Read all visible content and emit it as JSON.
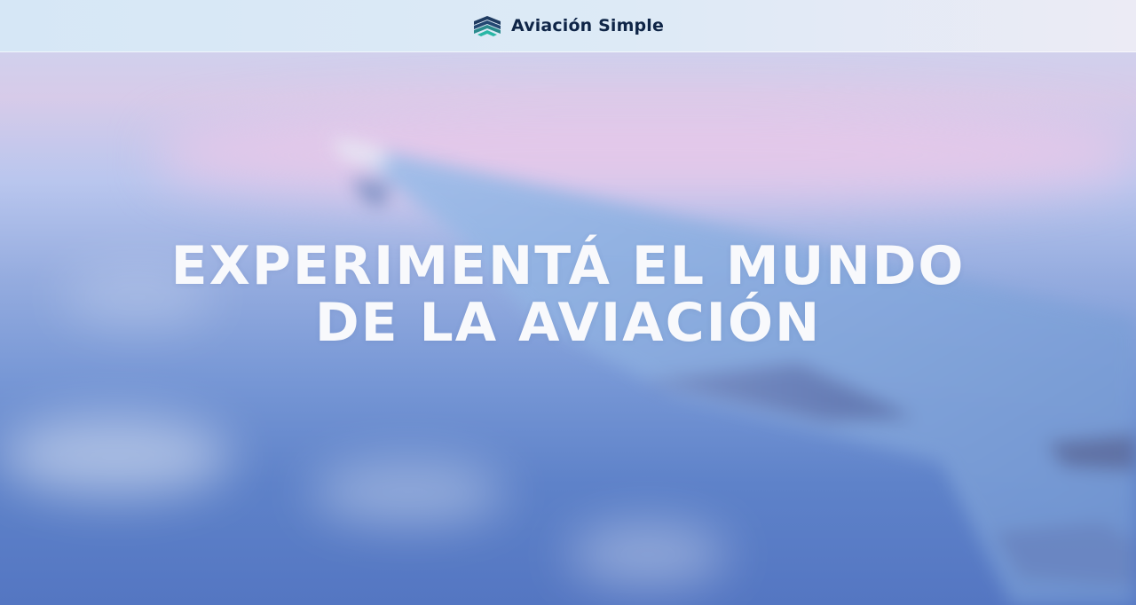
{
  "header": {
    "brand": {
      "name": "Aviación Simple",
      "icon": "layered-chevrons-logo-icon"
    }
  },
  "hero": {
    "title_line_1": "EXPERIMENTÁ EL MUNDO",
    "title_line_2": "DE LA AVIACIÓN"
  },
  "colors": {
    "brand_text": "#0f2547",
    "header_background": "#d6e7f6",
    "hero_text": "#f8f9fc",
    "sky_top": "#c9d6f1",
    "sky_bottom": "#5476c2",
    "accent_pink": "#eec8e8"
  }
}
